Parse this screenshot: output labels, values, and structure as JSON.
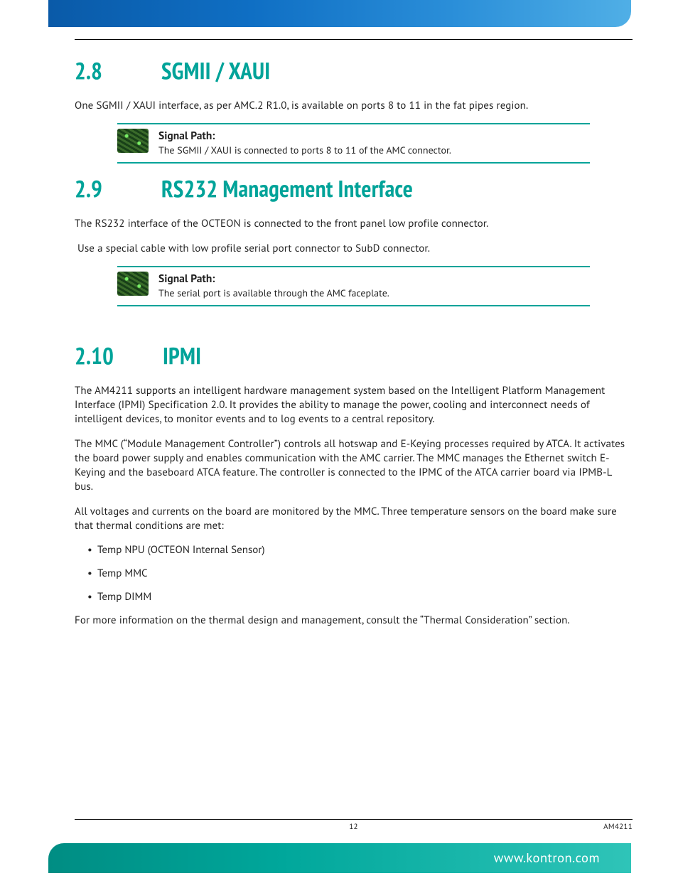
{
  "sections": {
    "sgmii": {
      "num": "2.8",
      "title": "SGMII / XAUI",
      "intro": "One SGMII / XAUI interface, as per AMC.2 R1.0, is available on ports 8 to 11 in the fat pipes region.",
      "note_label": "Signal Path:",
      "note_text": "The SGMII / XAUI is connected to ports 8 to 11 of the AMC connector."
    },
    "rs232": {
      "num": "2.9",
      "title": "RS232 Management Interface",
      "para1": "The RS232 interface of the OCTEON is connected to the front panel low profile connector.",
      "para2": "Use a special cable with low profile serial port connector to SubD connector.",
      "note_label": "Signal Path:",
      "note_text": "The serial port is available through the AMC faceplate."
    },
    "ipmi": {
      "num": "2.10",
      "title": "IPMI",
      "para1": "The AM4211 supports an intelligent hardware management system based on the Intelligent Platform Management Interface (IPMI) Specification 2.0. It provides the ability to manage the power, cooling and interconnect needs of intelligent devices, to monitor events and to log events to a central repository.",
      "para2": "The MMC (“Module Management Controller”) controls all hotswap and E-Keying processes required by ATCA. It activates the board power supply and enables communication with the AMC carrier. The MMC manages the Ethernet switch E-Keying and the baseboard ATCA feature. The controller is connected to the IPMC of the ATCA carrier board via IPMB-L bus.",
      "para3": "All voltages and currents on the board are monitored by the MMC. Three temperature sensors on the board make sure that thermal conditions are met:",
      "temps": [
        "Temp NPU (OCTEON Internal Sensor)",
        "Temp MMC",
        "Temp DIMM"
      ],
      "para4": "For more information on the thermal design and management, consult the  “Thermal Consideration” section."
    }
  },
  "footer": {
    "page_number": "12",
    "model": "AM4211",
    "url": "www.kontron.com"
  }
}
